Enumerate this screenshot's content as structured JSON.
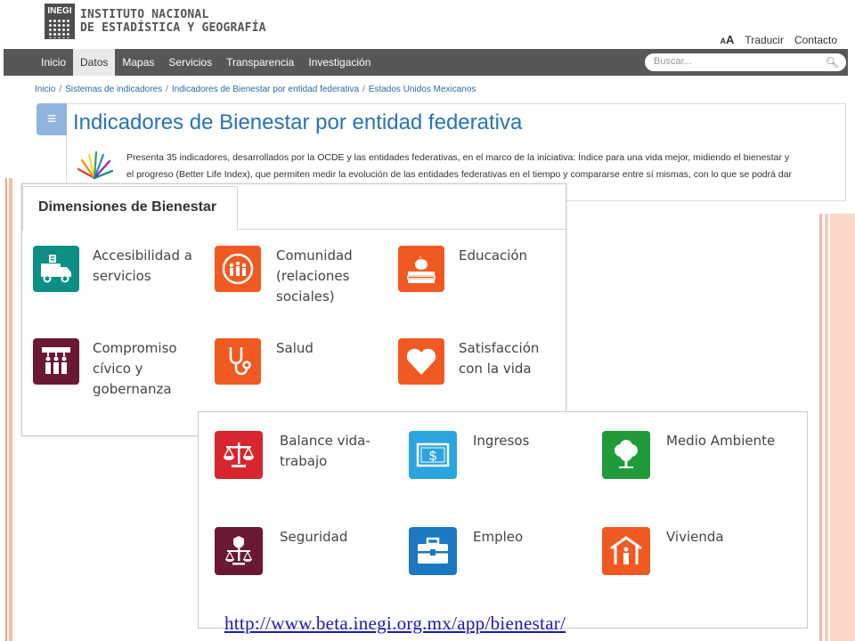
{
  "header": {
    "logo_box": "INEGI",
    "logo_line1": "INSTITUTO NACIONAL",
    "logo_line2": "DE ESTADÍSTICA Y GEOGRAFÍA",
    "text_size_small": "A",
    "text_size_big": "A",
    "translate": "Traducir",
    "contact": "Contacto"
  },
  "nav": {
    "items": [
      "Inicio",
      "Datos",
      "Mapas",
      "Servicios",
      "Transparencia",
      "Investigación"
    ],
    "active_index": 1,
    "search_placeholder": "Buscar..."
  },
  "breadcrumb": [
    "Inicio",
    "Sistemas de indicadores",
    "Indicadores de Bienestar por entidad federativa",
    "Estados Unidos Mexicanos"
  ],
  "main": {
    "title": "Indicadores de Bienestar por entidad federativa",
    "intro_line1": "Presenta 35 indicadores, desarrollados por la OCDE y las entidades federativas, en el marco de la iniciativa: Índice para una vida mejor, midiendo el bienestar y",
    "intro_line2": "el progreso (Better Life Index), que permiten medir la evolución de las entidades federativas en el tiempo y compararse entre sí mismas, con lo que se podrá dar"
  },
  "dimensions": {
    "tab_label": "Dimensiones de Bienestar",
    "items": [
      {
        "label": "Accesibilidad a servicios",
        "color": "#0e8f86",
        "icon": "ambulance-icon"
      },
      {
        "label": "Comunidad (relaciones sociales)",
        "color": "#f05a22",
        "icon": "community-icon"
      },
      {
        "label": "Educación",
        "color": "#f05a22",
        "icon": "education-icon"
      },
      {
        "label": "Compromiso cívico y gobernanza",
        "color": "#6b1833",
        "icon": "civic-icon"
      },
      {
        "label": "Salud",
        "color": "#f05a22",
        "icon": "stethoscope-icon"
      },
      {
        "label": "Satisfacción con la vida",
        "color": "#f05a22",
        "icon": "heart-icon"
      },
      {
        "label": "Balance vida-trabajo",
        "color": "#d8262e",
        "icon": "scale-icon"
      },
      {
        "label": "Ingresos",
        "color": "#2aa5dd",
        "icon": "money-icon"
      },
      {
        "label": "Medio Ambiente",
        "color": "#1f9b3a",
        "icon": "tree-icon"
      },
      {
        "label": "Seguridad",
        "color": "#6b1833",
        "icon": "security-scale-icon"
      },
      {
        "label": "Empleo",
        "color": "#1b78c2",
        "icon": "briefcase-icon"
      },
      {
        "label": "Vivienda",
        "color": "#f05a22",
        "icon": "house-icon"
      }
    ]
  },
  "footer_url": "http://www.beta.inegi.org.mx/app/bienestar/"
}
